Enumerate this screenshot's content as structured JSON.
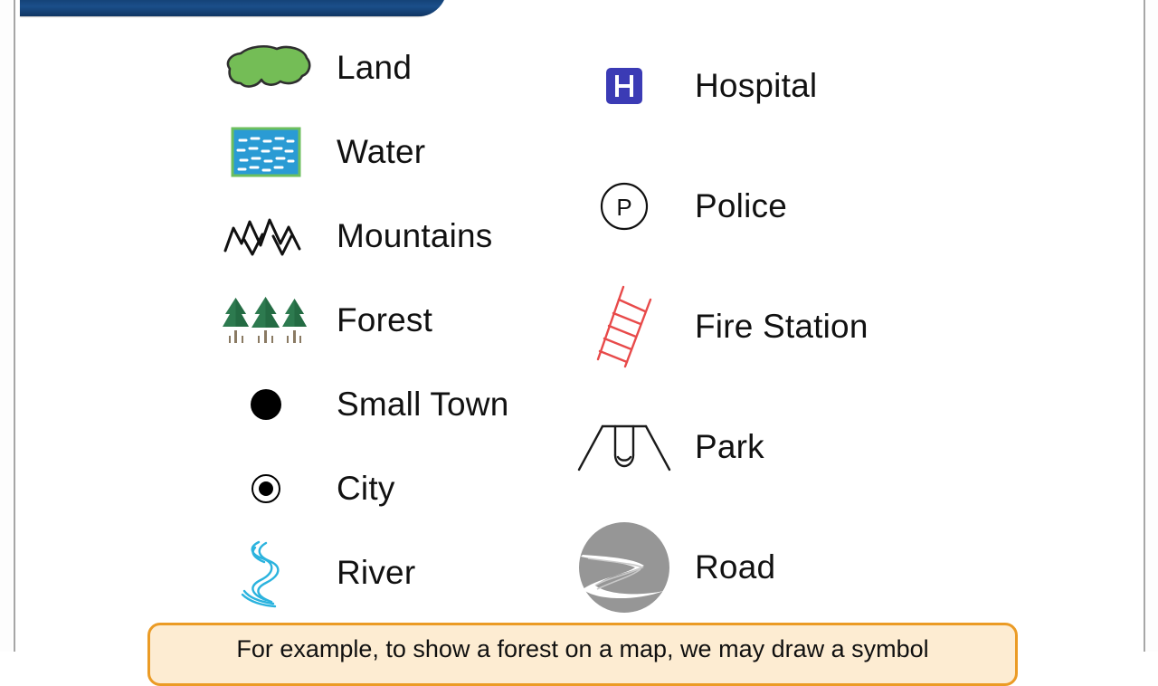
{
  "banner": {
    "title": "",
    "color": "#1b4f8a"
  },
  "legend": {
    "left_column": [
      {
        "label": "Land",
        "icon": "land-blob-icon",
        "colors": {
          "fill": "#74bd56",
          "stroke": "#2f2f2f"
        }
      },
      {
        "label": "Water",
        "icon": "water-swatch-icon",
        "colors": {
          "fill": "#2a9bd4",
          "stroke": "#6cbf5e",
          "dashes": "#ffffff"
        }
      },
      {
        "label": "Mountains",
        "icon": "mountains-zigzag-icon",
        "colors": {
          "stroke": "#111111"
        }
      },
      {
        "label": "Forest",
        "icon": "forest-trees-icon",
        "colors": {
          "fill": "#2d7a4f",
          "trunk": "#8a7a63"
        }
      },
      {
        "label": "Small Town",
        "icon": "filled-circle-icon",
        "colors": {
          "fill": "#000000"
        }
      },
      {
        "label": "City",
        "icon": "ringed-dot-icon",
        "colors": {
          "fill": "#000000",
          "stroke": "#000000"
        }
      },
      {
        "label": "River",
        "icon": "river-lines-icon",
        "colors": {
          "stroke": "#2bb3de"
        }
      }
    ],
    "right_column": [
      {
        "label": "Hospital",
        "icon": "hospital-h-icon",
        "colors": {
          "fill": "#3b3bb5",
          "glyph": "#ffffff"
        },
        "glyph": "H"
      },
      {
        "label": "Police",
        "icon": "police-p-circle-icon",
        "colors": {
          "stroke": "#111111",
          "glyph": "#111111"
        },
        "glyph": "P"
      },
      {
        "label": "Fire Station",
        "icon": "fire-ladder-icon",
        "colors": {
          "stroke": "#e84a4a"
        }
      },
      {
        "label": "Park",
        "icon": "park-swing-icon",
        "colors": {
          "stroke": "#1a1a1a"
        }
      },
      {
        "label": "Road",
        "icon": "road-circle-icon",
        "colors": {
          "fill": "#969696",
          "road": "#ffffff"
        }
      }
    ]
  },
  "callout": {
    "text": "For example, to show a forest on a map, we may draw a symbol",
    "border_color": "#eb9b25",
    "fill_color": "#fdecd2"
  }
}
